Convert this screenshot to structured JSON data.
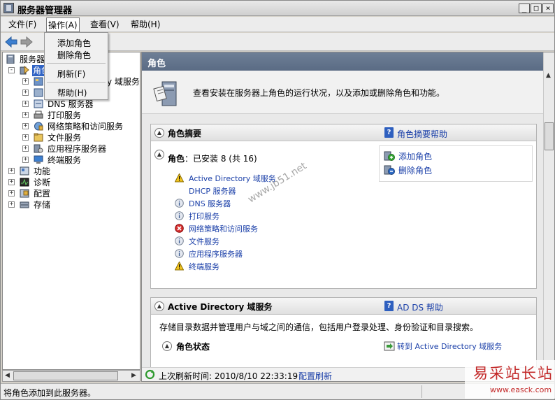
{
  "window": {
    "title": "服务器管理器"
  },
  "menu": {
    "file": "文件(F)",
    "action": "操作(A)",
    "view": "查看(V)",
    "help": "帮助(H)"
  },
  "action_menu": {
    "add_roles": "添加角色",
    "remove_roles": "删除角色",
    "refresh": "刷新(F)",
    "help": "帮助(H)"
  },
  "tree": {
    "root": "服务器",
    "roles": "角色",
    "ad_partial": "y 域服务",
    "dns": "DNS 服务器",
    "print": "打印服务",
    "npas": "网络策略和访问服务",
    "file": "文件服务",
    "app_server": "应用程序服务器",
    "terminal": "终端服务",
    "features": "功能",
    "diagnostics": "诊断",
    "configuration": "配置",
    "storage": "存储"
  },
  "main": {
    "header": "角色",
    "intro": "查看安装在服务器上角色的运行状况，以及添加或删除角色和功能。",
    "summary": {
      "title": "角色摘要",
      "help": "角色摘要帮助",
      "roles_label": "角色",
      "roles_count": "：已安装 8 (共 16)",
      "add_roles": "添加角色",
      "remove_roles": "删除角色",
      "items": [
        {
          "label": "Active Directory 域服务",
          "status": "warning"
        },
        {
          "label": "DHCP 服务器",
          "status": "none"
        },
        {
          "label": "DNS 服务器",
          "status": "info"
        },
        {
          "label": "打印服务",
          "status": "info"
        },
        {
          "label": "网络策略和访问服务",
          "status": "error"
        },
        {
          "label": "文件服务",
          "status": "info"
        },
        {
          "label": "应用程序服务器",
          "status": "info"
        },
        {
          "label": "终端服务",
          "status": "warning"
        }
      ]
    },
    "ad_section": {
      "title": "Active Directory 域服务",
      "help": "AD DS 帮助",
      "description": "存储目录数据并管理用户与域之间的通信，包括用户登录处理、身份验证和目录搜索。",
      "role_status": "角色状态",
      "goto": "转到 Active Directory 域服务"
    },
    "refresh": {
      "text": "上次刷新时间: 2010/8/10 22:33:19",
      "link": "配置刷新"
    }
  },
  "statusbar": {
    "text": "将角色添加到此服务器。"
  },
  "watermark": "www.jb51.net",
  "corner_logo": {
    "title": "易采站长站",
    "url": "www.easck.com"
  },
  "colors": {
    "link": "#1a3fa8",
    "header": "#5f7089",
    "selection": "#3164c5"
  }
}
